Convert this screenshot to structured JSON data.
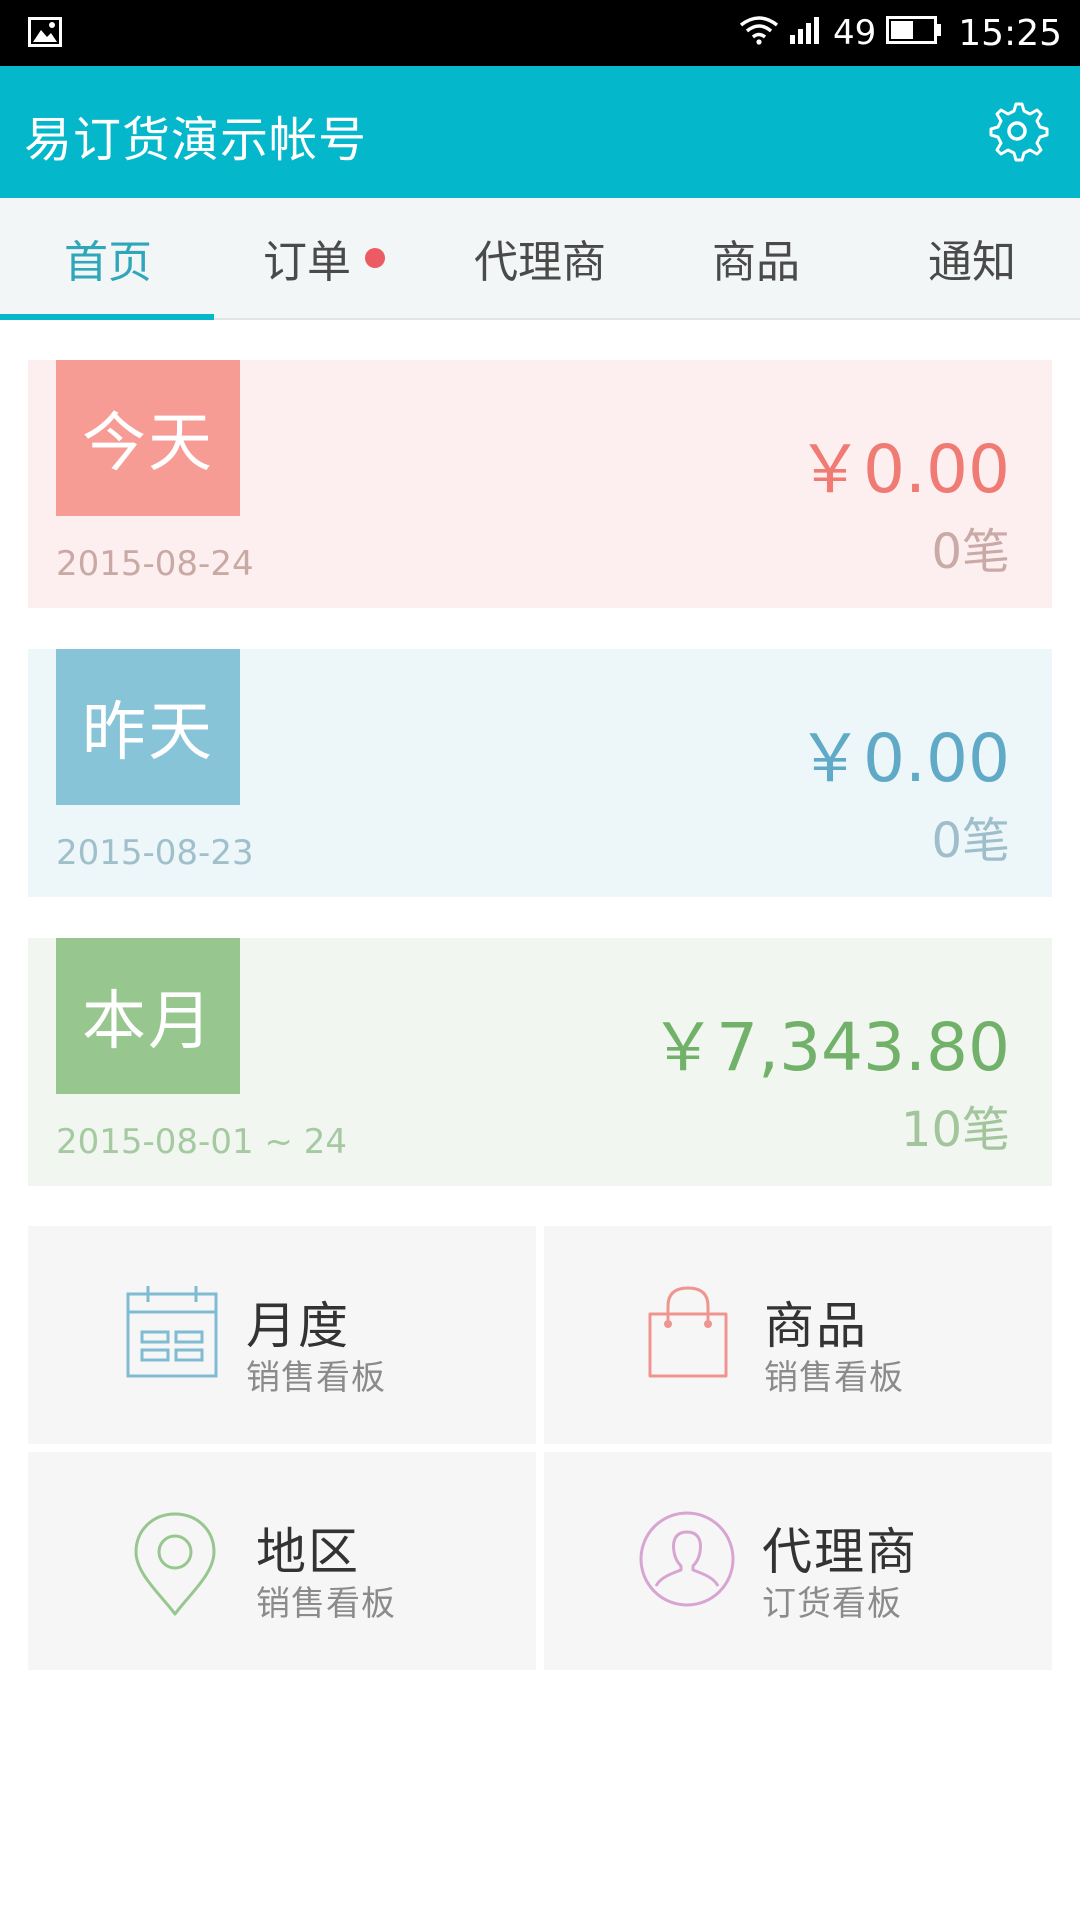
{
  "status_bar": {
    "battery_percent": "49",
    "time": "15:25",
    "icons": [
      "image-icon",
      "wifi-icon",
      "signal-icon",
      "battery-icon"
    ]
  },
  "app_bar": {
    "title": "易订货演示帐号",
    "settings_icon": "gear-icon"
  },
  "tabs": [
    {
      "label": "首页",
      "active": true
    },
    {
      "label": "订单",
      "has_badge": true
    },
    {
      "label": "代理商"
    },
    {
      "label": "商品"
    },
    {
      "label": "通知"
    }
  ],
  "summary": {
    "today": {
      "tag": "今天",
      "date": "2015-08-24",
      "amount": "￥0.00",
      "count": "0笔"
    },
    "yesterday": {
      "tag": "昨天",
      "date": "2015-08-23",
      "amount": "￥0.00",
      "count": "0笔"
    },
    "month": {
      "tag": "本月",
      "date": "2015-08-01 ~ 24",
      "amount": "￥7,343.80",
      "count": "10笔"
    }
  },
  "dashboards": [
    {
      "title": "月度",
      "subtitle": "销售看板",
      "icon": "calendar-icon"
    },
    {
      "title": "商品",
      "subtitle": "销售看板",
      "icon": "shopping-bag-icon"
    },
    {
      "title": "地区",
      "subtitle": "销售看板",
      "icon": "location-pin-icon"
    },
    {
      "title": "代理商",
      "subtitle": "订货看板",
      "icon": "person-icon"
    }
  ],
  "colors": {
    "primary": "#04b7cb",
    "today": "#f79b95",
    "yesterday": "#88c4d8",
    "month": "#98c68f",
    "badge": "#ec5a63"
  }
}
